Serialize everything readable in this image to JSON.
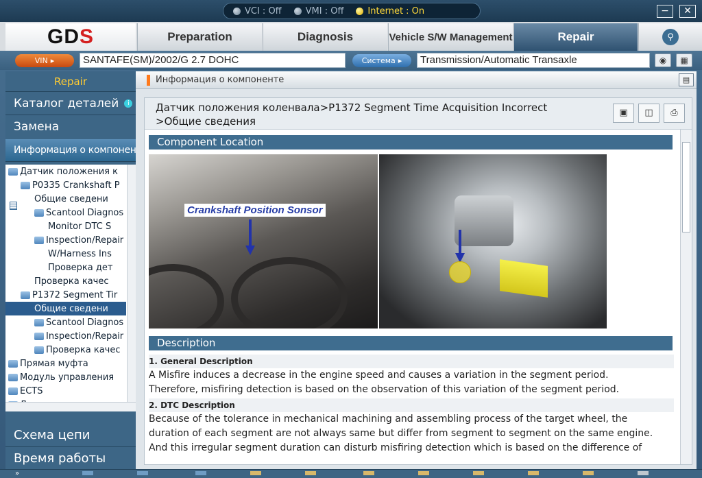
{
  "status": {
    "vci": "VCI : Off",
    "vmi": "VMI : Off",
    "internet": "Internet : On"
  },
  "window": {
    "minimize": "−",
    "close": "✕"
  },
  "logo": {
    "prefix": "GD",
    "suffix": "S"
  },
  "tabs": [
    {
      "label": "Preparation"
    },
    {
      "label": "Diagnosis"
    },
    {
      "label": "Vehicle S/W Management"
    },
    {
      "label": "Repair"
    }
  ],
  "vinrow": {
    "vin_btn": "VIN",
    "vin_value": "SANTAFE(SM)/2002/G 2.7 DOHC",
    "system_btn": "Система",
    "system_value": "Transmission/Automatic Transaxle"
  },
  "sidebar": {
    "header": "Repair",
    "items": [
      {
        "label": "Каталог деталей"
      },
      {
        "label": "Замена"
      },
      {
        "label": "Информация о компоненте"
      }
    ],
    "bottom": [
      {
        "label": "Схема цепи"
      },
      {
        "label": "Время работы"
      }
    ]
  },
  "tree": [
    "Датчик положения к",
    "P0335  Crankshaft  P",
    "Общие сведени",
    "Scantool Diagnos",
    "Monitor DTC S",
    "Inspection/Repair",
    "W/Harness Ins",
    "Проверка дет",
    "Проверка  качес",
    "P1372  Segment  Tir",
    "Общие сведени",
    "Scantool Diagnos",
    "Inspection/Repair",
    "Проверка  качес",
    "Прямая муфта",
    "Модуль  управления",
    "ECTS",
    "Датчик скорости по"
  ],
  "main": {
    "header": "Информация о компоненте",
    "breadcrumb_line1": "Датчик положения коленвала>P1372 Segment Time Acquisition Incorrect",
    "breadcrumb_line2": ">Общие сведения",
    "section_location": "Component Location",
    "photo_label": "Crankshaft Position Sonsor",
    "section_description": "Description",
    "general_title": "1. General Description",
    "general_text_1": "A Misfire induces a decrease in the engine speed and causes a variation in the segment period.",
    "general_text_2": "Therefore, misfiring detection is based on the observation of this variation of the segment period.",
    "dtc_title": "2. DTC Description",
    "dtc_text_1": "Because of the tolerance in mechanical machining and assembling process of the target wheel, the",
    "dtc_text_2": "duration of each segment are not always same but differ from segment to segment on the same engine.",
    "dtc_text_3": "And this irregular segment duration can disturb misfiring detection which is based on the difference of"
  },
  "colors": {
    "accent_orange": "#ff7a1c",
    "section_blue": "#3f6d8f",
    "internet_on": "#ffd93a",
    "repair_header": "#ffcc33"
  }
}
